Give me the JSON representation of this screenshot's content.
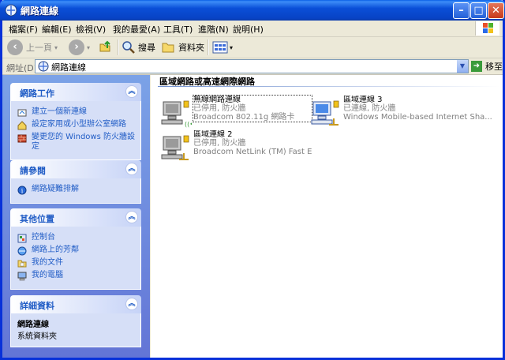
{
  "window": {
    "title": "網路連線",
    "min_glyph": "–",
    "max_glyph": "□",
    "close_glyph": "✕"
  },
  "menu": [
    "檔案(F)",
    "編輯(E)",
    "檢視(V)",
    "我的最愛(A)",
    "工具(T)",
    "進階(N)",
    "說明(H)"
  ],
  "toolbar": {
    "back_label": "上一頁",
    "search_label": "搜尋",
    "folders_label": "資料夾"
  },
  "address": {
    "label": "網址(D)",
    "value": "網路連線",
    "go_label": "移至"
  },
  "sidebar": {
    "tasks": {
      "title": "網路工作",
      "items": [
        "建立一個新連線",
        "設定家用或小型辦公室網路",
        "變更您的 Windows 防火牆設定"
      ]
    },
    "see_also": {
      "title": "請參閱",
      "items": [
        "網路疑難排解"
      ]
    },
    "other_places": {
      "title": "其他位置",
      "items": [
        "控制台",
        "網路上的芳鄰",
        "我的文件",
        "我的電腦"
      ]
    },
    "details": {
      "title": "詳細資料",
      "name": "網路連線",
      "type": "系統資料夾"
    }
  },
  "main": {
    "group_title": "區域網路或高速網際網路",
    "connections": [
      {
        "name": "無線網路連線",
        "status": "已停用, 防火牆",
        "device": "Broadcom 802.11g 網路卡"
      },
      {
        "name": "區域連線 3",
        "status": "已連線, 防火牆",
        "device": "Windows Mobile-based Internet Sha..."
      },
      {
        "name": "區域連線 2",
        "status": "已停用, 防火牆",
        "device": "Broadcom NetLink (TM) Fast Ether..."
      }
    ]
  },
  "colors": {
    "titlebar": "#0a4fd8",
    "sidebar": "#6f8de0",
    "link": "#215dc6",
    "status_text": "#808080"
  }
}
